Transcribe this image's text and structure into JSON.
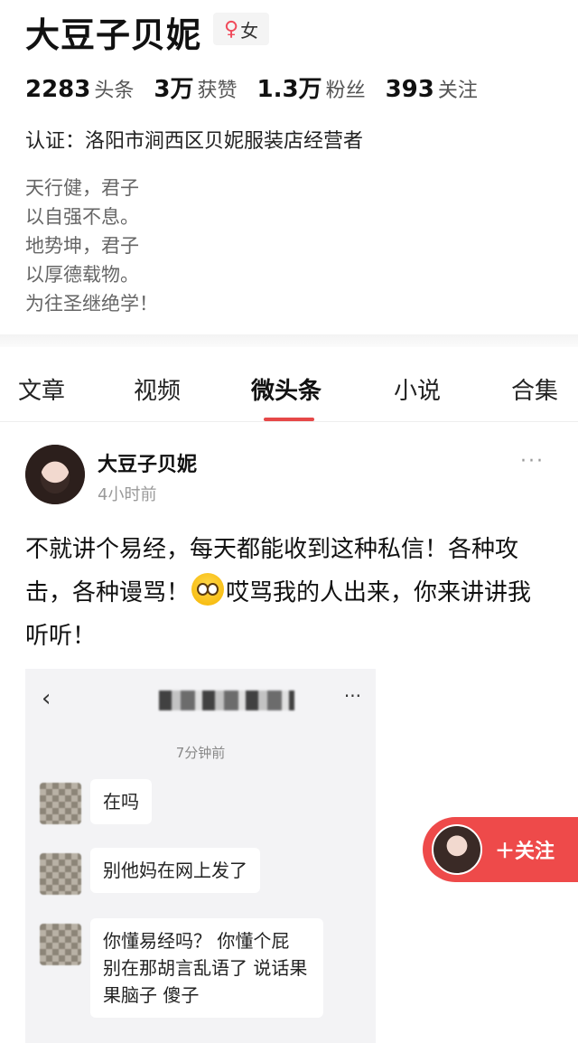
{
  "profile": {
    "name": "大豆子贝妮",
    "gender_symbol": "♀",
    "gender_label": "女",
    "stats": [
      {
        "num": "2283",
        "label": "头条"
      },
      {
        "num": "3万",
        "label": "获赞"
      },
      {
        "num": "1.3万",
        "label": "粉丝"
      },
      {
        "num": "393",
        "label": "关注"
      }
    ],
    "certification": "认证：洛阳市涧西区贝妮服装店经营者",
    "bio": [
      "天行健，君子",
      "以自强不息。",
      "地势坤，君子",
      "以厚德载物。",
      "为往圣继绝学！"
    ]
  },
  "tabs": [
    "文章",
    "视频",
    "微头条",
    "小说",
    "合集"
  ],
  "active_tab": "微头条",
  "accent_color": "#e64848",
  "post": {
    "author": "大豆子贝妮",
    "time": "4小时前",
    "more_icon": "more-dots-icon",
    "text_before_emoji": "不就讲个易经，每天都能收到这种私信！各种攻击，各种谩骂！",
    "emoji": "pleading-face-emoji",
    "text_after_emoji": "哎骂我的人出来，你来讲讲我听听！",
    "screenshot": {
      "back_icon": "back-chevron-icon",
      "more_label": "···",
      "timestamp": "7分钟前",
      "messages": [
        "在吗",
        "别他妈在网上发了",
        "你懂易经吗？ 你懂个屁 别在那胡言乱语了 说话果果脑子 傻子"
      ]
    }
  },
  "follow_button": {
    "label": "＋关注"
  }
}
